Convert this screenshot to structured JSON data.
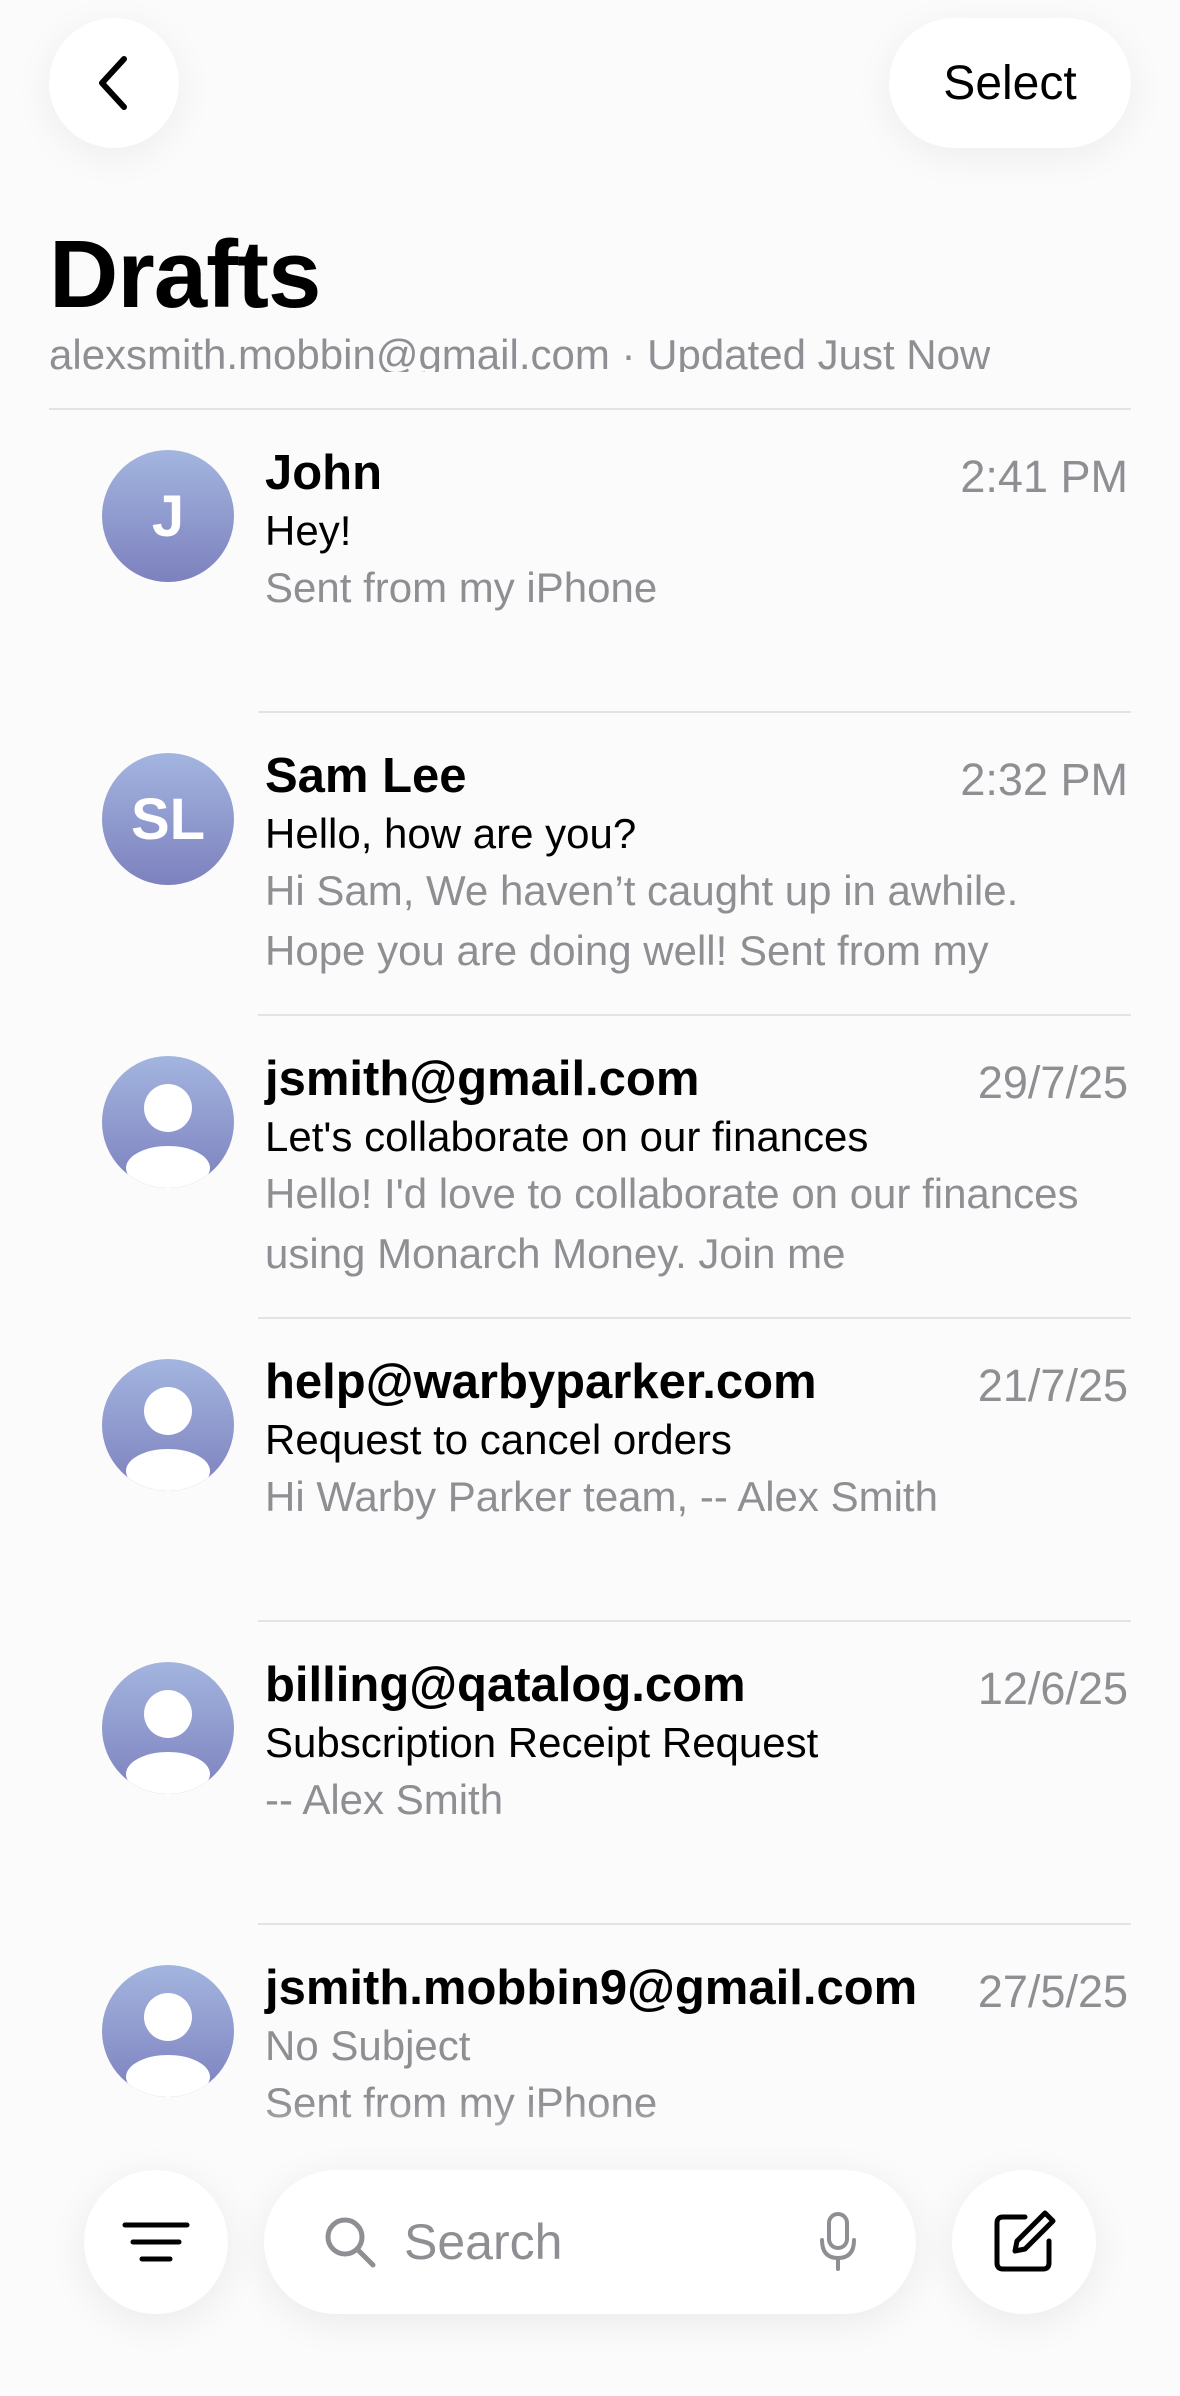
{
  "header": {
    "select_label": "Select",
    "title": "Drafts",
    "subtitle": "alexsmith.mobbin@gmail.com · Updated Just Now"
  },
  "drafts": [
    {
      "initials": "J",
      "sender": "John",
      "date": "2:41 PM",
      "subject": "Hey!",
      "preview": "Sent from my iPhone"
    },
    {
      "initials": "SL",
      "sender": "Sam Lee",
      "date": "2:32 PM",
      "subject": "Hello, how are you?",
      "preview": "Hi Sam, We haven’t caught up in awhile. Hope you are doing well! Sent from my"
    },
    {
      "initials": "",
      "sender": "jsmith@gmail.com",
      "date": "29/7/25",
      "subject": "Let's collaborate on our finances",
      "preview": "Hello! I'd love to collaborate on our finances using Monarch Money. Join me"
    },
    {
      "initials": "",
      "sender": "help@warbyparker.com",
      "date": "21/7/25",
      "subject": "Request to cancel orders",
      "preview": "Hi Warby Parker team, -- Alex Smith"
    },
    {
      "initials": "",
      "sender": "billing@qatalog.com",
      "date": "12/6/25",
      "subject": "Subscription Receipt Request",
      "preview": "-- Alex Smith"
    },
    {
      "initials": "",
      "sender": "jsmith.mobbin9@gmail.com",
      "date": "27/5/25",
      "subject": "No Subject",
      "preview": "Sent from my iPhone"
    }
  ],
  "toolbar": {
    "search_placeholder": "Search"
  },
  "icons": {
    "back": "chevron-left-icon",
    "filter": "filter-lines-icon",
    "search": "magnifier-icon",
    "mic": "microphone-icon",
    "compose": "compose-icon",
    "avatar_placeholder": "person-icon"
  },
  "colors": {
    "avatar_gradient_top": "#a3b5df",
    "avatar_gradient_bottom": "#7d81be",
    "secondary_text": "#8e8e93"
  }
}
